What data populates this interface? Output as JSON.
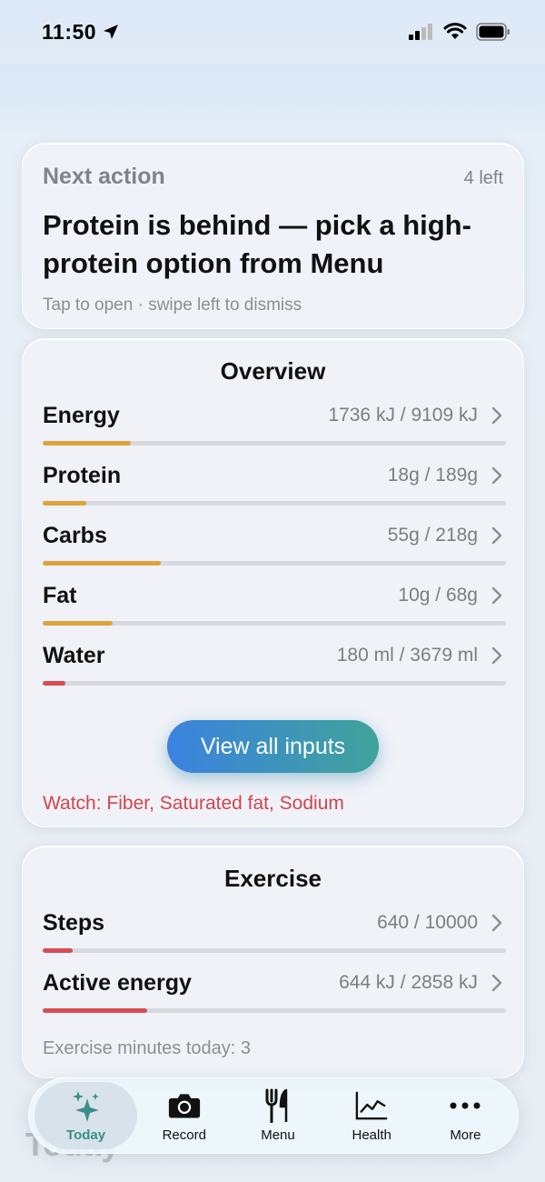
{
  "status_bar": {
    "time": "11:50"
  },
  "next_action": {
    "label": "Next action",
    "count": "4 left",
    "title": "Protein is behind — pick a high-protein option from Menu",
    "hint": "Tap to open · swipe left to dismiss"
  },
  "overview": {
    "title": "Overview",
    "metrics": [
      {
        "name": "Energy",
        "value": "1736 kJ / 9109 kJ",
        "progress": 0.19,
        "color": "#e0a23c"
      },
      {
        "name": "Protein",
        "value": "18g / 189g",
        "progress": 0.095,
        "color": "#e0a23c"
      },
      {
        "name": "Carbs",
        "value": "55g / 218g",
        "progress": 0.255,
        "color": "#e0a23c"
      },
      {
        "name": "Fat",
        "value": "10g / 68g",
        "progress": 0.15,
        "color": "#e0a23c"
      },
      {
        "name": "Water",
        "value": "180 ml / 3679 ml",
        "progress": 0.049,
        "color": "#d94c55"
      }
    ],
    "cta_label": "View all inputs",
    "watch_text": "Watch: Fiber, Saturated fat, Sodium"
  },
  "exercise": {
    "title": "Exercise",
    "metrics": [
      {
        "name": "Steps",
        "value": "640 / 10000",
        "progress": 0.064,
        "color": "#d94c55"
      },
      {
        "name": "Active energy",
        "value": "644 kJ / 2858 kJ",
        "progress": 0.225,
        "color": "#d94c55"
      }
    ],
    "minutes_text": "Exercise minutes today: 3"
  },
  "background_heading": "Today",
  "tabs": [
    {
      "label": "Today",
      "icon": "sparkles-icon",
      "active": true
    },
    {
      "label": "Record",
      "icon": "camera-icon",
      "active": false
    },
    {
      "label": "Menu",
      "icon": "fork-knife-icon",
      "active": false
    },
    {
      "label": "Health",
      "icon": "chart-line-icon",
      "active": false
    },
    {
      "label": "More",
      "icon": "ellipsis-icon",
      "active": false
    }
  ]
}
